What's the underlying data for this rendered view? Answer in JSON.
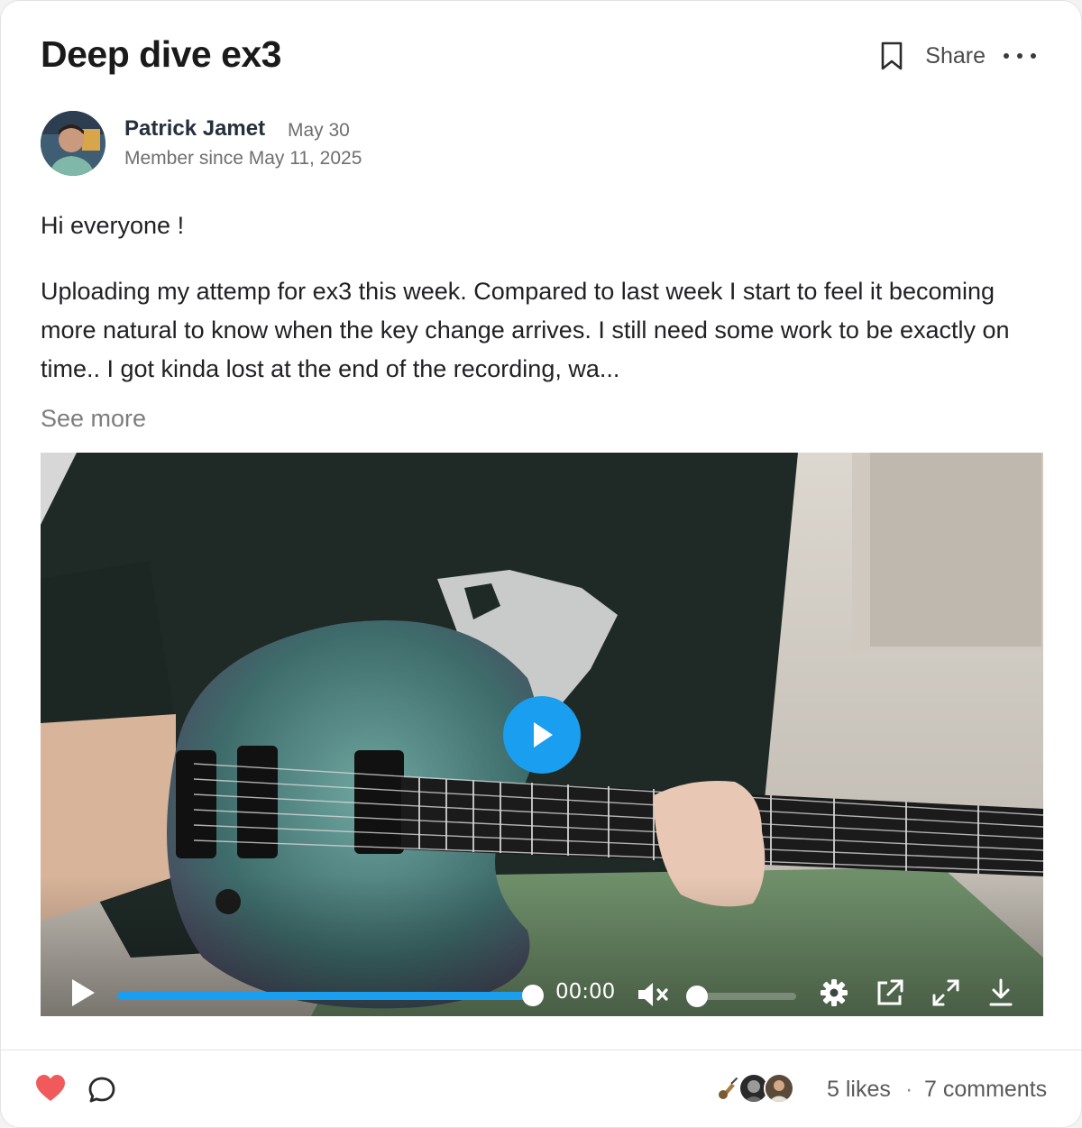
{
  "post": {
    "title": "Deep dive ex3",
    "share_label": "Share",
    "author": {
      "name": "Patrick Jamet",
      "date": "May 30",
      "member_since": "Member since May 11, 2025"
    },
    "greeting": "Hi everyone !",
    "body": "Uploading my attemp for ex3 this week. Compared to last week I start to feel it becoming more natural to know when the key change arrives.  I still need some work to be exactly on time..  I got kinda lost at the end of the recording, wa...",
    "see_more_label": "See more"
  },
  "video": {
    "time": "00:00",
    "progress": 1.0,
    "volume": 0.0,
    "muted": true,
    "accent_color": "#1a9ef0"
  },
  "footer": {
    "likes_label": "5 likes",
    "separator": "·",
    "comments_label": "7 comments",
    "liked": true,
    "like_color": "#f05a5a"
  },
  "icons": [
    "bookmark-icon",
    "more-icon",
    "play-icon",
    "volume-muted-icon",
    "settings-icon",
    "open-external-icon",
    "fullscreen-icon",
    "download-icon",
    "heart-icon",
    "comment-icon"
  ]
}
